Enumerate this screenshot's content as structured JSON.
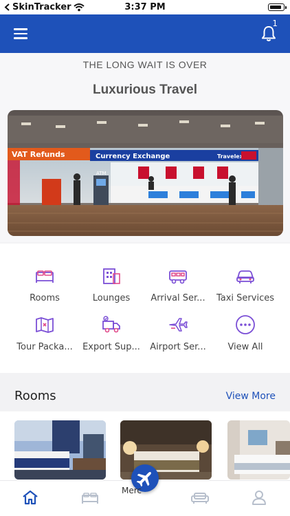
{
  "status_bar": {
    "carrier": "SkinTracker",
    "time": "3:37 PM"
  },
  "app_bar": {
    "notification_count": "1",
    "icons": [
      "menu-icon",
      "bell-icon"
    ]
  },
  "hero": {
    "tagline": "THE LONG WAIT IS OVER",
    "title": "Luxurious Travel",
    "image_signs": {
      "vat": "VAT Refunds",
      "currency": "Currency Exchange",
      "brand": "Travelex",
      "atm": "ATM"
    }
  },
  "services": [
    {
      "label": "Rooms",
      "icon": "bed-icon"
    },
    {
      "label": "Lounges",
      "icon": "building-icon"
    },
    {
      "label": "Arrival Ser...",
      "icon": "van-icon"
    },
    {
      "label": "Taxi Services",
      "icon": "car-icon"
    },
    {
      "label": "Tour Packa...",
      "icon": "map-icon"
    },
    {
      "label": "Export Sup...",
      "icon": "truck-icon"
    },
    {
      "label": "Airport Ser...",
      "icon": "airplane-icon"
    },
    {
      "label": "View All",
      "icon": "more-icon"
    }
  ],
  "rooms": {
    "title": "Rooms",
    "view_more": "View More"
  },
  "bottom_nav": {
    "fab_label": "Merc",
    "items": [
      "home-icon",
      "bed-icon",
      "sofa-icon",
      "profile-icon"
    ]
  },
  "colors": {
    "primary": "#1e51b9",
    "accent_icon": "#7b4fd6",
    "icon_pink": "#e04a8a"
  }
}
